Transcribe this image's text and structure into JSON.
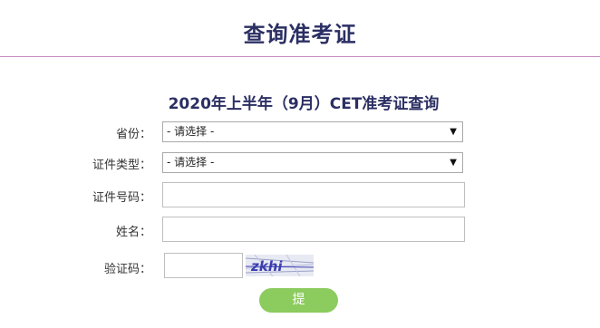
{
  "header": {
    "title": "查询准考证"
  },
  "form": {
    "heading": "2020年上半年（9月）CET准考证查询",
    "province": {
      "label": "省份：",
      "selected": "- 请选择 -"
    },
    "id_type": {
      "label": "证件类型：",
      "selected": "- 请选择 -"
    },
    "id_number": {
      "label": "证件号码：",
      "value": ""
    },
    "name": {
      "label": "姓名：",
      "value": ""
    },
    "captcha": {
      "label": "验证码：",
      "value": "",
      "image_text": "zkhi"
    },
    "submit_label": "提 交"
  },
  "colors": {
    "title": "#2b2f63",
    "rule": "#c48bc0",
    "submit": "#8ccb5e",
    "captcha_text": "#3b3fb0"
  }
}
